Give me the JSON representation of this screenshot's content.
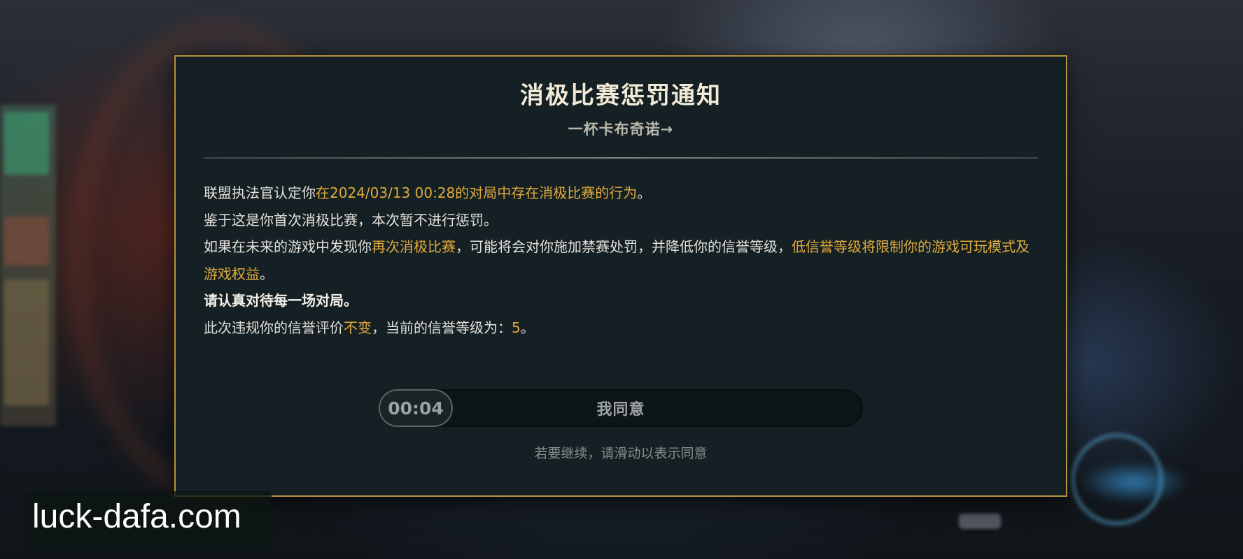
{
  "dialog": {
    "title": "消极比赛惩罚通知",
    "subtitle": "一杯卡布奇诺→",
    "lines": [
      {
        "segments": [
          {
            "text": "联盟执法官认定你",
            "style": "normal"
          },
          {
            "text": "在2024/03/13 00:28的对局中存在消极比赛的行为",
            "style": "highlight"
          },
          {
            "text": "。",
            "style": "normal"
          }
        ]
      },
      {
        "segments": [
          {
            "text": "鉴于这是你首次消极比赛，本次暂不进行惩罚。",
            "style": "normal"
          }
        ]
      },
      {
        "segments": [
          {
            "text": "如果在未来的游戏中发现你",
            "style": "normal"
          },
          {
            "text": "再次消极比赛",
            "style": "highlight"
          },
          {
            "text": "，可能将会对你施加禁赛处罚，并降低你的信誉等级，",
            "style": "normal"
          },
          {
            "text": "低信誉等级将限制你的游戏可玩模式及游戏权益",
            "style": "highlight"
          },
          {
            "text": "。",
            "style": "normal"
          }
        ]
      },
      {
        "segments": [
          {
            "text": "请认真对待每一场对局。",
            "style": "strong"
          }
        ]
      },
      {
        "segments": [
          {
            "text": "此次违规你的信誉评价",
            "style": "normal"
          },
          {
            "text": "不变",
            "style": "highlight"
          },
          {
            "text": "，当前的信誉等级为：",
            "style": "normal"
          },
          {
            "text": "5",
            "style": "highlight"
          },
          {
            "text": "。",
            "style": "normal"
          }
        ]
      }
    ],
    "slider": {
      "timer": "00:04",
      "label": "我同意",
      "progress": 0
    },
    "hint": "若要继续，请滑动以表示同意"
  },
  "watermark": "luck-dafa.com",
  "colors": {
    "highlight": "#e0aa3c",
    "border": "#b8953f",
    "panel": "#142024"
  }
}
